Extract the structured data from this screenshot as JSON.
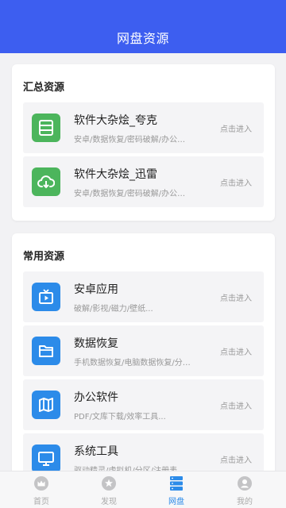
{
  "header": {
    "title": "网盘资源"
  },
  "summary": {
    "title": "汇总资源",
    "items": [
      {
        "title": "软件大杂烩_夸克",
        "subtitle": "安卓/数据恢复/密码破解/办公软件",
        "action": "点击进入",
        "icon": "storage-icon"
      },
      {
        "title": "软件大杂烩_迅雷",
        "subtitle": "安卓/数据恢复/密码破解/办公软件",
        "action": "点击进入",
        "icon": "cloud-download-icon"
      }
    ]
  },
  "common": {
    "title": "常用资源",
    "items": [
      {
        "title": "安卓应用",
        "subtitle": "破解/影视/磁力/壁纸...",
        "action": "点击进入",
        "icon": "tv-play-icon"
      },
      {
        "title": "数据恢复",
        "subtitle": "手机数据恢复/电脑数据恢复/分区恢复",
        "action": "点击进入",
        "icon": "folder-icon"
      },
      {
        "title": "办公软件",
        "subtitle": "PDF/文库下载/效率工具...",
        "action": "点击进入",
        "icon": "map-book-icon"
      },
      {
        "title": "系统工具",
        "subtitle": "驱动精灵/虚拟机/分区/注册表",
        "action": "点击进入",
        "icon": "monitor-icon"
      }
    ]
  },
  "tabbar": {
    "tabs": [
      {
        "label": "首页",
        "icon": "crown-icon",
        "active": false
      },
      {
        "label": "发现",
        "icon": "star-icon",
        "active": false
      },
      {
        "label": "网盘",
        "icon": "storage-icon",
        "active": true
      },
      {
        "label": "我的",
        "icon": "user-icon",
        "active": false
      }
    ]
  },
  "colors": {
    "header": "#3d5ef0",
    "green": "#4cb55c",
    "blue": "#2c8be9",
    "active_tab": "#2c8be9"
  }
}
